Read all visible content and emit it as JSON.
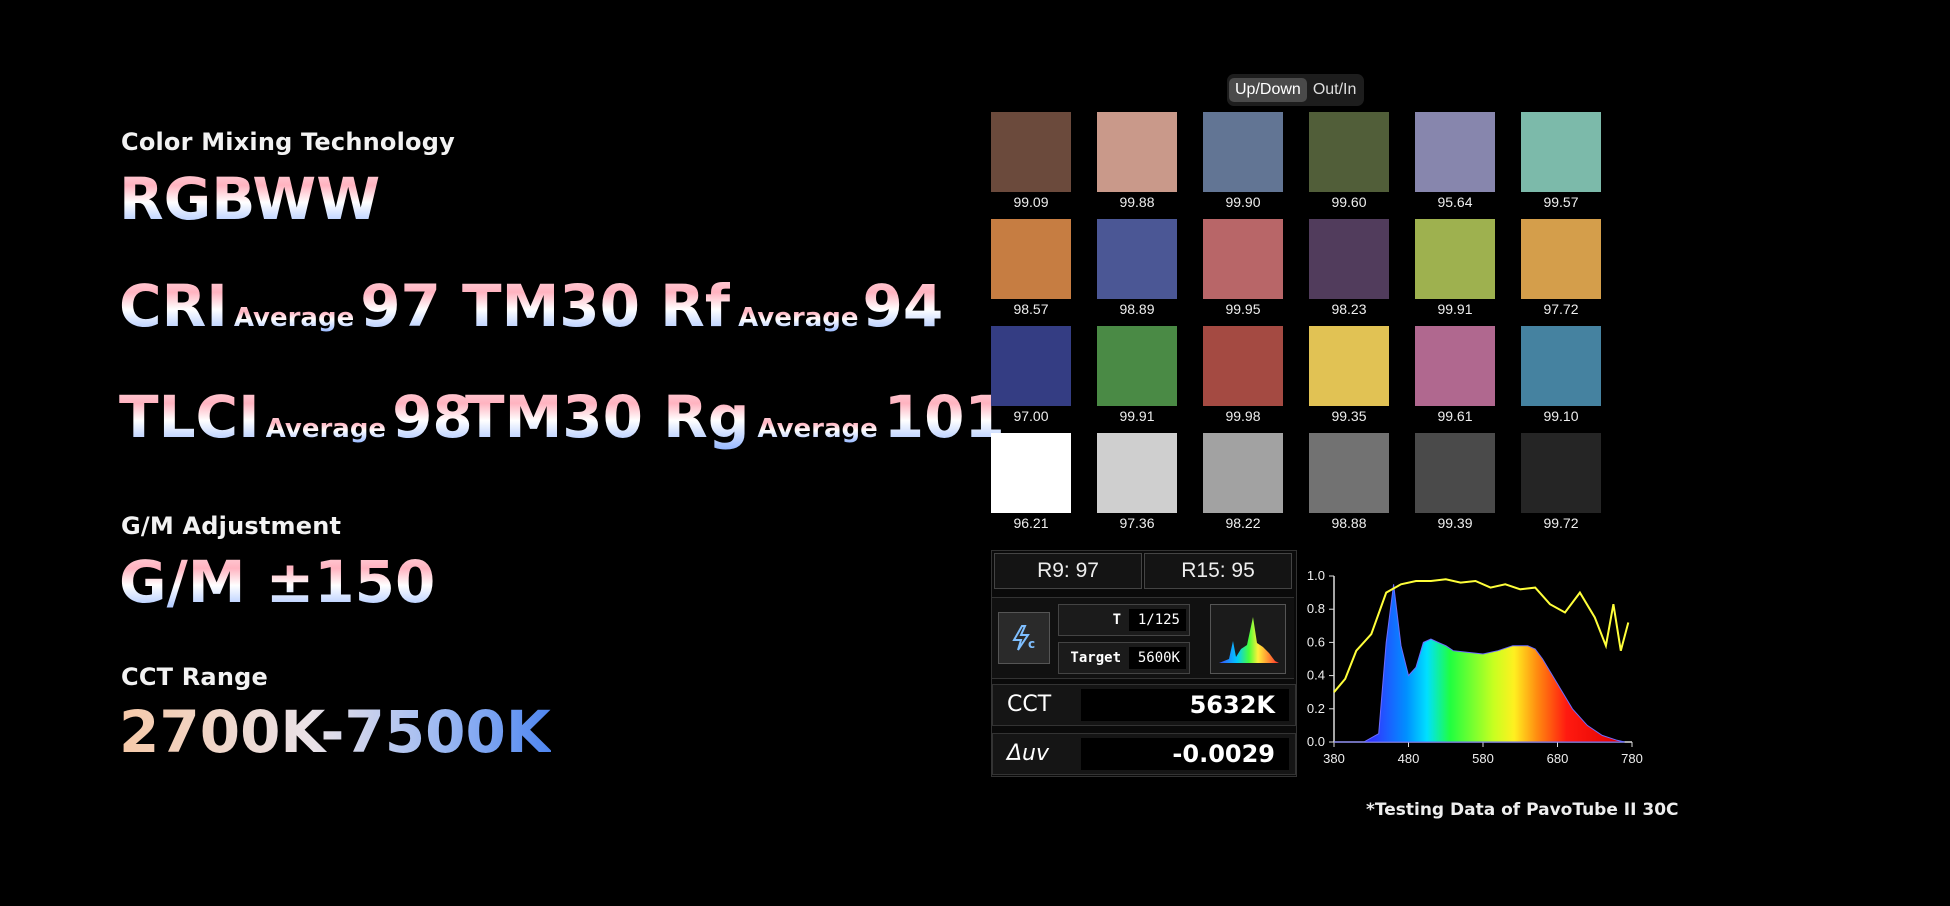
{
  "left": {
    "color_mixing": {
      "label": "Color Mixing Technology",
      "value": "RGBWW"
    },
    "metrics": [
      {
        "name": "CRI",
        "avg": "Average",
        "value": "97"
      },
      {
        "name": "TM30 Rf",
        "avg": "Average",
        "value": "94"
      },
      {
        "name": "TLCI",
        "avg": "Average",
        "value": "98"
      },
      {
        "name": "TM30 Rg",
        "avg": "Average",
        "value": "101"
      }
    ],
    "gm": {
      "label": "G/M Adjustment",
      "value": "G/M ±150"
    },
    "cct": {
      "label": "CCT Range",
      "value": "2700K-7500K"
    }
  },
  "toggle": {
    "options": [
      "Up/Down",
      "Out/In"
    ],
    "active": 0
  },
  "swatches": [
    {
      "color": "#6b4a3c",
      "value": "99.09"
    },
    {
      "color": "#c9998a",
      "value": "99.88"
    },
    {
      "color": "#627594",
      "value": "99.90"
    },
    {
      "color": "#515e39",
      "value": "99.60"
    },
    {
      "color": "#8786ad",
      "value": "95.64"
    },
    {
      "color": "#7cbaaa",
      "value": "99.57"
    },
    {
      "color": "#c67d42",
      "value": "98.57"
    },
    {
      "color": "#4b5795",
      "value": "98.89"
    },
    {
      "color": "#b86668",
      "value": "99.95"
    },
    {
      "color": "#513c5c",
      "value": "98.23"
    },
    {
      "color": "#9eb14f",
      "value": "99.91"
    },
    {
      "color": "#d49e4b",
      "value": "97.72"
    },
    {
      "color": "#343d83",
      "value": "97.00"
    },
    {
      "color": "#4a8a45",
      "value": "99.91"
    },
    {
      "color": "#a44a42",
      "value": "99.98"
    },
    {
      "color": "#e1c254",
      "value": "99.35"
    },
    {
      "color": "#b0688f",
      "value": "99.61"
    },
    {
      "color": "#4582a0",
      "value": "99.10"
    },
    {
      "color": "#ffffff",
      "value": "96.21"
    },
    {
      "color": "#cfcfcf",
      "value": "97.36"
    },
    {
      "color": "#a2a2a2",
      "value": "98.22"
    },
    {
      "color": "#727272",
      "value": "98.88"
    },
    {
      "color": "#4a4a4a",
      "value": "99.39"
    },
    {
      "color": "#252525",
      "value": "99.72"
    }
  ],
  "meter": {
    "r9": "R9: 97",
    "r15": "R15: 95",
    "t_label": "T",
    "t_value": "1/125",
    "target_label": "Target",
    "target_value": "5600K",
    "cct_label": "CCT",
    "cct_value": "5632K",
    "duv_label": "Δuv",
    "duv_value": "-0.0029"
  },
  "chart_data": {
    "type": "area",
    "x_ticks": [
      380,
      480,
      580,
      680,
      780
    ],
    "y_ticks": [
      "0.0",
      "0.2",
      "0.4",
      "0.6",
      "0.8",
      "1.0"
    ],
    "xlim": [
      380,
      780
    ],
    "ylim": [
      0,
      1.0
    ],
    "series": [
      {
        "style": "spectrum-fill",
        "x": [
          380,
          420,
          440,
          450,
          460,
          470,
          480,
          490,
          500,
          510,
          520,
          530,
          540,
          560,
          580,
          600,
          620,
          640,
          650,
          660,
          680,
          700,
          720,
          740,
          760,
          770
        ],
        "y": [
          0,
          0.0,
          0.05,
          0.6,
          0.95,
          0.58,
          0.4,
          0.45,
          0.6,
          0.62,
          0.6,
          0.58,
          0.55,
          0.54,
          0.53,
          0.55,
          0.58,
          0.58,
          0.56,
          0.5,
          0.35,
          0.2,
          0.1,
          0.04,
          0.01,
          0.0
        ]
      },
      {
        "style": "yellow-line",
        "x": [
          380,
          395,
          410,
          430,
          450,
          470,
          490,
          510,
          530,
          550,
          570,
          590,
          610,
          630,
          650,
          670,
          690,
          710,
          730,
          745,
          755,
          765,
          775
        ],
        "y": [
          0.3,
          0.38,
          0.55,
          0.65,
          0.9,
          0.95,
          0.97,
          0.97,
          0.98,
          0.96,
          0.97,
          0.93,
          0.95,
          0.92,
          0.93,
          0.83,
          0.78,
          0.9,
          0.75,
          0.58,
          0.83,
          0.55,
          0.72
        ]
      }
    ]
  },
  "footnote": "*Testing Data of PavoTube II 30C"
}
